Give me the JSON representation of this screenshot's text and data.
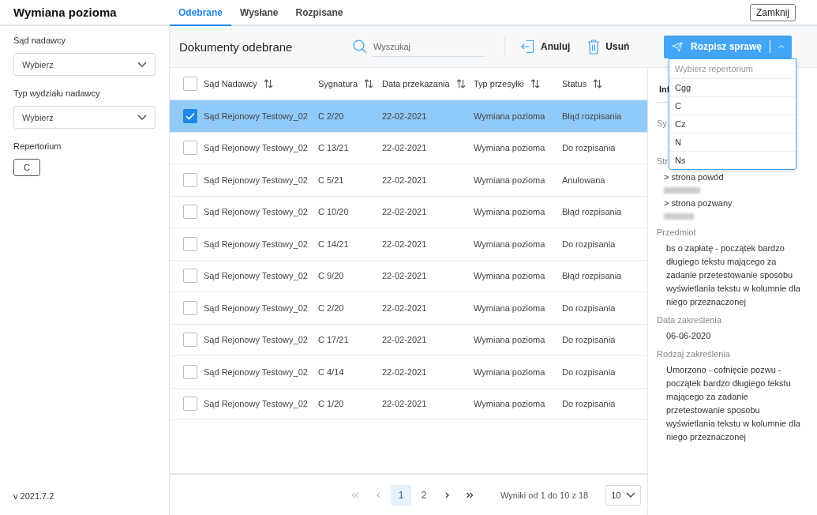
{
  "app_title": "Wymiana pozioma",
  "tabs": [
    {
      "label": "Odebrane",
      "selected": true
    },
    {
      "label": "Wysłane",
      "selected": false
    },
    {
      "label": "Rozpisane",
      "selected": false
    }
  ],
  "close_button": "Zamknij",
  "sidebar": {
    "filters": [
      {
        "kind": "select",
        "label": "Sąd nadawcy",
        "value": "Wybierz"
      },
      {
        "kind": "select",
        "label": "Typ wydziału nadawcy",
        "value": "Wybierz"
      },
      {
        "kind": "chip",
        "label": "Repertorium",
        "value": "C"
      }
    ],
    "version": "v 2021.7.2"
  },
  "toolbar": {
    "title": "Dokumenty odebrane",
    "search": {
      "placeholder": "Wyszukaj"
    },
    "actions": [
      {
        "kind": "cancel",
        "label": "Anuluj"
      },
      {
        "kind": "delete",
        "label": "Usuń"
      }
    ],
    "split_button": {
      "label": "Rozpisz sprawę",
      "expanded": true
    },
    "dropdown": {
      "placeholder": "Wybierz repertorium",
      "options": [
        "Cgg",
        "C",
        "Cz",
        "N",
        "Ns"
      ]
    }
  },
  "table": {
    "all_checked": false,
    "columns": [
      "Sąd Nadawcy",
      "Sygnatura",
      "Data przekazania",
      "Typ przesyłki",
      "Status"
    ],
    "rows": [
      {
        "selected": true,
        "cells": [
          "Sąd Rejonowy Testowy_02",
          "C 2/20",
          "22-02-2021",
          "Wymiana pozioma",
          "Błąd rozpisania"
        ]
      },
      {
        "selected": false,
        "cells": [
          "Sąd Rejonowy Testowy_02",
          "C 13/21",
          "22-02-2021",
          "Wymiana pozioma",
          "Do rozpisania"
        ]
      },
      {
        "selected": false,
        "cells": [
          "Sąd Rejonowy Testowy_02",
          "C 5/21",
          "22-02-2021",
          "Wymiana pozioma",
          "Anulowana"
        ]
      },
      {
        "selected": false,
        "cells": [
          "Sąd Rejonowy Testowy_02",
          "C 10/20",
          "22-02-2021",
          "Wymiana pozioma",
          "Błąd rozpisania"
        ]
      },
      {
        "selected": false,
        "cells": [
          "Sąd Rejonowy Testowy_02",
          "C 14/21",
          "22-02-2021",
          "Wymiana pozioma",
          "Do rozpisania"
        ]
      },
      {
        "selected": false,
        "cells": [
          "Sąd Rejonowy Testowy_02",
          "C 9/20",
          "22-02-2021",
          "Wymiana pozioma",
          "Błąd rozpisania"
        ]
      },
      {
        "selected": false,
        "cells": [
          "Sąd Rejonowy Testowy_02",
          "C 2/20",
          "22-02-2021",
          "Wymiana pozioma",
          "Do rozpisania"
        ]
      },
      {
        "selected": false,
        "cells": [
          "Sąd Rejonowy Testowy_02",
          "C 17/21",
          "22-02-2021",
          "Wymiana pozioma",
          "Do rozpisania"
        ]
      },
      {
        "selected": false,
        "cells": [
          "Sąd Rejonowy Testowy_02",
          "C 4/14",
          "22-02-2021",
          "Wymiana pozioma",
          "Do rozpisania"
        ]
      },
      {
        "selected": false,
        "cells": [
          "Sąd Rejonowy Testowy_02",
          "C 1/20",
          "22-02-2021",
          "Wymiana pozioma",
          "Do rozpisania"
        ]
      }
    ]
  },
  "pagination": {
    "pages": [
      {
        "label": "1",
        "selected": true
      },
      {
        "label": "2",
        "selected": false
      }
    ],
    "summary": "Wyniki od 1 do 10 z 18",
    "page_size": "10"
  },
  "details": {
    "heading": "Inf",
    "fields": [
      {
        "kind": "label",
        "text": "Sy"
      },
      {
        "kind": "label",
        "text": "Str"
      },
      {
        "kind": "party",
        "text": "> strona powód"
      },
      {
        "kind": "party",
        "text": "> strona pozwany"
      },
      {
        "kind": "label",
        "text": "Przedmiot"
      },
      {
        "kind": "value",
        "text": "bs o zapłatę - początek bardzo długiego tekstu mającego za zadanie przetestowanie sposobu wyświetlania tekstu w kolumnie dla niego przeznaczonej"
      },
      {
        "kind": "label",
        "text": "Data zakreślenia"
      },
      {
        "kind": "value",
        "text": "06-06-2020"
      },
      {
        "kind": "label",
        "text": "Rodzaj zakreślenia"
      },
      {
        "kind": "value",
        "text": "Umorzono - cofnięcie pozwu - początek bardzo długiego tekstu mającego za zadanie przetestowanie sposobu wyświetlania tekstu w kolumnie dla niego przeznaczonej"
      }
    ]
  }
}
